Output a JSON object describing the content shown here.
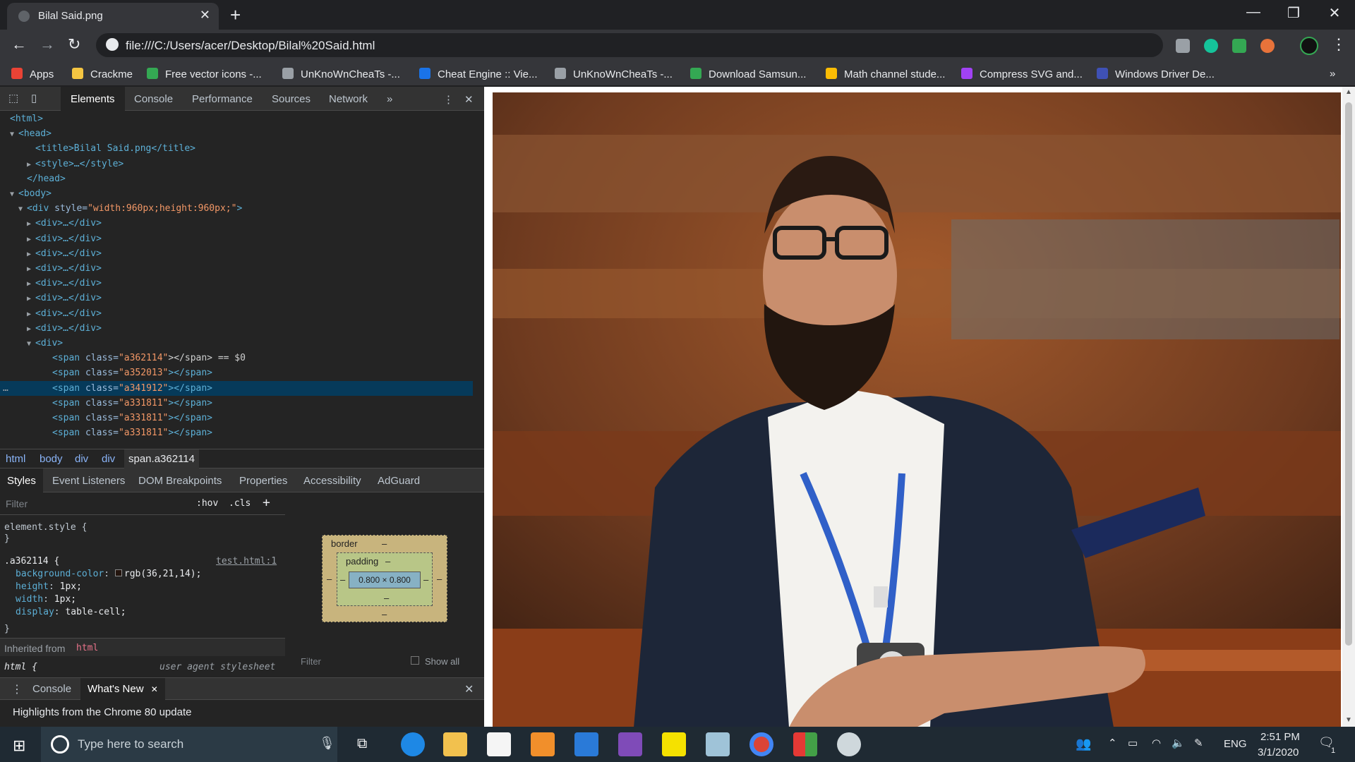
{
  "browser": {
    "tab_title": "Bilal Said.png",
    "tab_close": "✕",
    "new_tab": "+",
    "window_controls": [
      "—",
      "❐",
      "✕"
    ],
    "url": "file:///C:/Users/acer/Desktop/Bilal%20Said.html",
    "bookmarks": [
      {
        "label": "Apps",
        "color": "#ea4335"
      },
      {
        "label": "Crackme",
        "color": "#f4c542"
      },
      {
        "label": "Free vector icons -...",
        "color": "#34a853"
      },
      {
        "label": "UnKnoWnCheaTs -...",
        "color": "#9aa0a6"
      },
      {
        "label": "Cheat Engine :: Vie...",
        "color": "#1a73e8"
      },
      {
        "label": "UnKnoWnCheaTs -...",
        "color": "#9aa0a6"
      },
      {
        "label": "Download Samsun...",
        "color": "#34a853"
      },
      {
        "label": "Math channel stude...",
        "color": "#fbbc04"
      },
      {
        "label": "Compress SVG and...",
        "color": "#a142f4"
      },
      {
        "label": "Windows Driver De...",
        "color": "#3f51b5"
      }
    ],
    "more_bookmarks": "»"
  },
  "devtools": {
    "tabs": [
      "Elements",
      "Console",
      "Performance",
      "Sources",
      "Network",
      "»"
    ],
    "elements": [
      {
        "indent": 0,
        "arrow": "",
        "open": "<html>",
        "attr": "",
        "val": "",
        "rest": ""
      },
      {
        "indent": 1,
        "arrow": "▼",
        "open": "<head>",
        "attr": "",
        "val": "",
        "rest": ""
      },
      {
        "indent": 3,
        "arrow": "",
        "open": "<title>",
        "attr": "",
        "val": "",
        "rest": "Bilal Said.png</title>"
      },
      {
        "indent": 3,
        "arrow": "▶",
        "open": "<style>",
        "attr": "",
        "val": "",
        "rest": "…</style>"
      },
      {
        "indent": 2,
        "arrow": "",
        "open": "</head>",
        "attr": "",
        "val": "",
        "rest": ""
      },
      {
        "indent": 1,
        "arrow": "▼",
        "open": "<body>",
        "attr": "",
        "val": "",
        "rest": ""
      },
      {
        "indent": 2,
        "arrow": "▼",
        "open": "<div ",
        "attr": "style=",
        "val": "\"width:960px;height:960px;\"",
        "rest": ">"
      },
      {
        "indent": 3,
        "arrow": "▶",
        "open": "<div>",
        "attr": "",
        "val": "",
        "rest": "…</div>"
      },
      {
        "indent": 3,
        "arrow": "▶",
        "open": "<div>",
        "attr": "",
        "val": "",
        "rest": "…</div>"
      },
      {
        "indent": 3,
        "arrow": "▶",
        "open": "<div>",
        "attr": "",
        "val": "",
        "rest": "…</div>"
      },
      {
        "indent": 3,
        "arrow": "▶",
        "open": "<div>",
        "attr": "",
        "val": "",
        "rest": "…</div>"
      },
      {
        "indent": 3,
        "arrow": "▶",
        "open": "<div>",
        "attr": "",
        "val": "",
        "rest": "…</div>"
      },
      {
        "indent": 3,
        "arrow": "▶",
        "open": "<div>",
        "attr": "",
        "val": "",
        "rest": "…</div>"
      },
      {
        "indent": 3,
        "arrow": "▶",
        "open": "<div>",
        "attr": "",
        "val": "",
        "rest": "…</div>"
      },
      {
        "indent": 3,
        "arrow": "▶",
        "open": "<div>",
        "attr": "",
        "val": "",
        "rest": "…</div>"
      },
      {
        "indent": 3,
        "arrow": "▼",
        "open": "<div>",
        "attr": "",
        "val": "",
        "rest": ""
      },
      {
        "indent": 5,
        "arrow": "",
        "open": "<span ",
        "attr": "class=",
        "val": "\"a362114\"",
        "rest": "></span> == $0"
      },
      {
        "indent": 5,
        "arrow": "",
        "open": "<span ",
        "attr": "class=",
        "val": "\"a352013\"",
        "rest": "></span>"
      },
      {
        "indent": 5,
        "arrow": "",
        "open": "<span ",
        "attr": "class=",
        "val": "\"a341912\"",
        "rest": "></span>"
      },
      {
        "indent": 5,
        "arrow": "",
        "open": "<span ",
        "attr": "class=",
        "val": "\"a331811\"",
        "rest": "></span>"
      },
      {
        "indent": 5,
        "arrow": "",
        "open": "<span ",
        "attr": "class=",
        "val": "\"a331811\"",
        "rest": "></span>"
      },
      {
        "indent": 5,
        "arrow": "",
        "open": "<span ",
        "attr": "class=",
        "val": "\"a331811\"",
        "rest": "></span>"
      }
    ],
    "selected_marker": "…",
    "breadcrumbs": [
      "html",
      "body",
      "div",
      "div",
      "span.a362114"
    ],
    "subtabs": [
      "Styles",
      "Event Listeners",
      "DOM Breakpoints",
      "Properties",
      "Accessibility",
      "AdGuard"
    ],
    "filter_placeholder": "Filter",
    "filter_hov": ":hov",
    "filter_cls": ".cls",
    "filter_add": "+",
    "styles": {
      "element_style": "element.style {",
      "close_brace": "}",
      "rule_selector": ".a362114 {",
      "rule_source": "test.html:1",
      "props": [
        {
          "name": "background-color",
          "value": "rgb(36,21,14);"
        },
        {
          "name": "height",
          "value": "1px;"
        },
        {
          "name": "width",
          "value": "1px;"
        },
        {
          "name": "display",
          "value": "table-cell;"
        }
      ],
      "inherited": "Inherited from",
      "inherited_tag": "html",
      "html_rule": "html {",
      "ua": "user agent stylesheet"
    },
    "boxmodel": {
      "border": "border",
      "padding": "padding",
      "dash": "–",
      "content": "0.800 × 0.800",
      "filter": "Filter",
      "show_all": "Show all"
    },
    "drawer_tabs": [
      "Console",
      "What's New"
    ],
    "drawer_body": "Highlights from the Chrome 80 update"
  },
  "taskbar": {
    "search_placeholder": "Type here to search",
    "language": "ENG",
    "time": "2:51 PM",
    "date": "3/1/2020",
    "notification_count": "1"
  }
}
